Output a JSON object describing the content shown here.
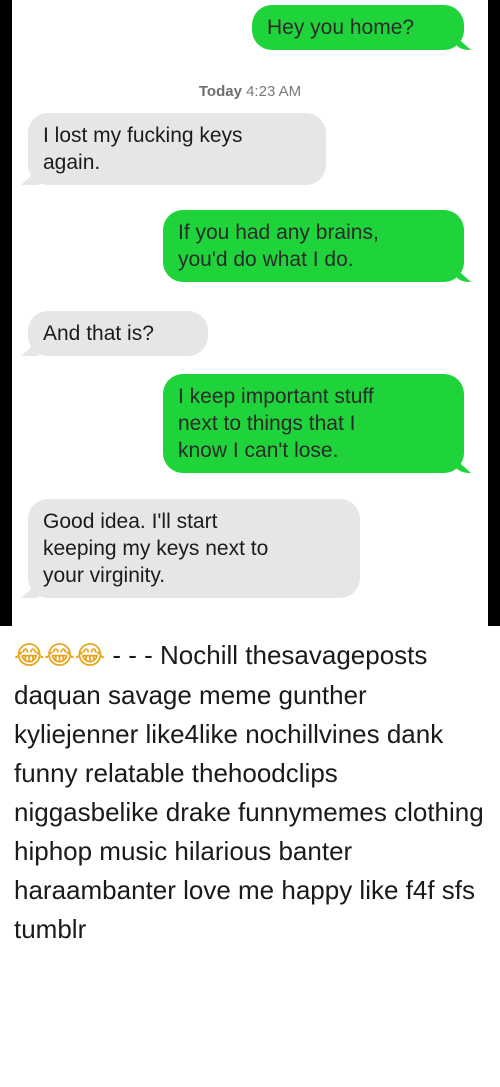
{
  "conversation": {
    "messages": [
      {
        "direction": "outgoing",
        "text": "Hey you home?"
      },
      {
        "direction": "incoming",
        "text": "I lost my fucking keys\nagain."
      },
      {
        "direction": "outgoing",
        "text": "If you had any brains,\nyou'd do what I do."
      },
      {
        "direction": "incoming",
        "text": "And that is?"
      },
      {
        "direction": "outgoing",
        "text": "I keep important stuff\nnext to things that I\nknow I can't lose."
      },
      {
        "direction": "incoming",
        "text": "Good idea. I'll start\nkeeping my keys next to\nyour virginity."
      }
    ],
    "timestamp": {
      "day": "Today",
      "time": "4:23 AM"
    }
  },
  "caption": {
    "emojis": "😂😂😂",
    "text": "- - - Nochill thesavageposts daquan savage meme gunther kyliejenner like4like nochillvines dank funny relatable thehoodclips niggasbelike drake funnymemes clothing hiphop music hilarious banter haraambanter love me happy like f4f sfs tumblr"
  },
  "colors": {
    "outgoing_bubble": "#1fd43b",
    "incoming_bubble": "#e6e6e6",
    "side_bars": "#000000"
  }
}
